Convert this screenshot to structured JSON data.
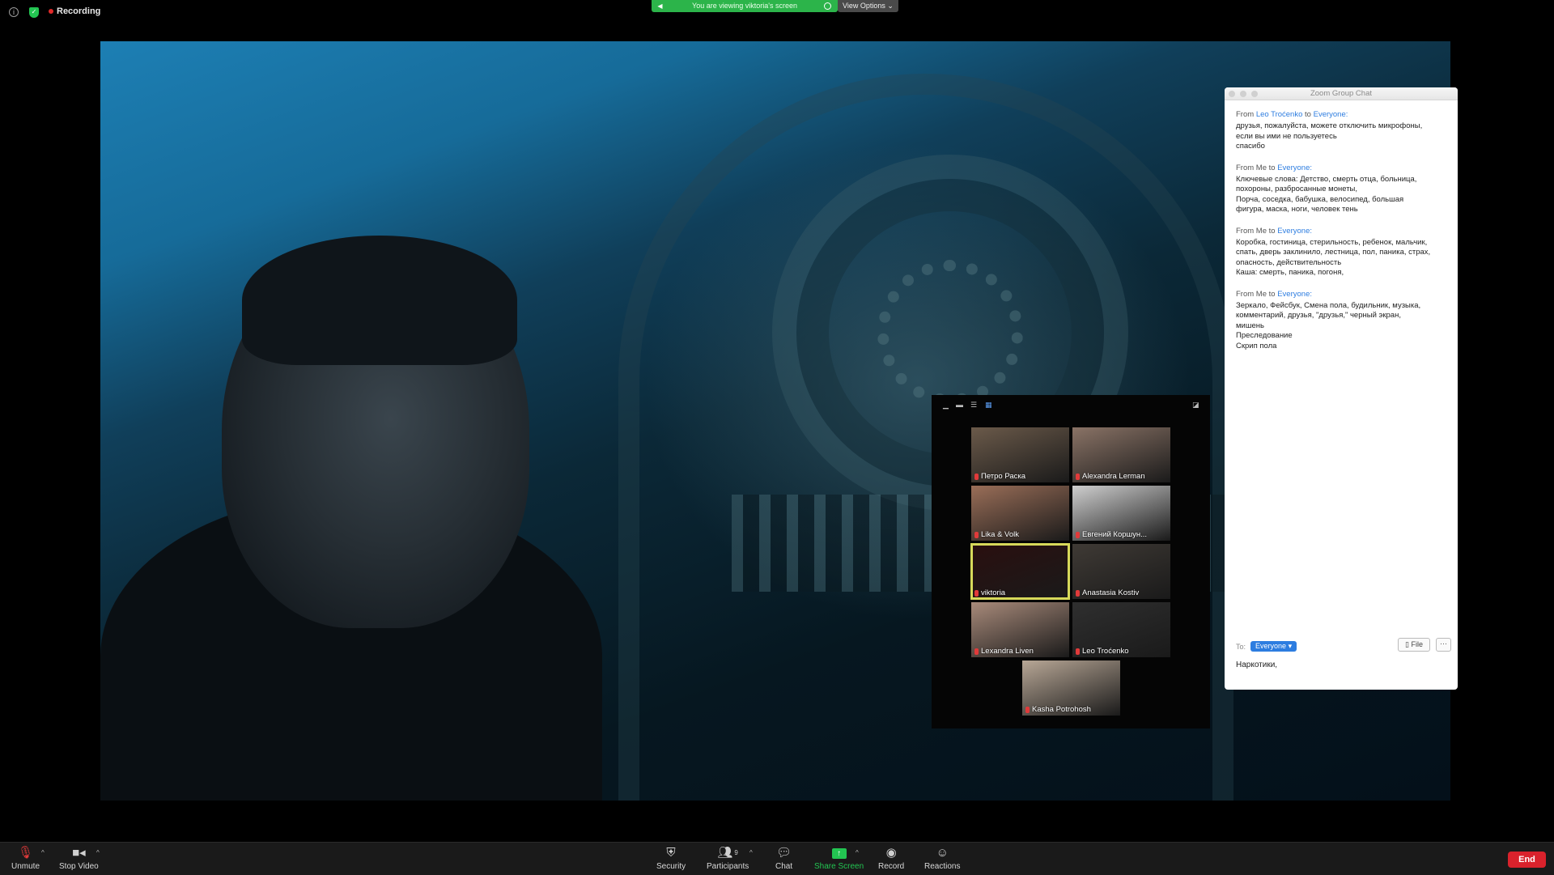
{
  "topbar": {
    "recording_label": "Recording",
    "share_banner": "You are viewing viktoria's screen",
    "view_options": "View Options"
  },
  "gallery": {
    "tiles": [
      {
        "name": "Петро Раска",
        "color": "#6b5a4a"
      },
      {
        "name": "Alexandra Lerman",
        "color": "#8a7366"
      },
      {
        "name": "Lika & Volk",
        "color": "#9a6e58"
      },
      {
        "name": "Евгений Коршун...",
        "color": "#cfcfcf"
      },
      {
        "name": "viktoria",
        "color": "#2a0f0f"
      },
      {
        "name": "Anastasia Kostiv",
        "color": "#3f3a35"
      },
      {
        "name": "Lexandra Liven",
        "color": "#a88a7a"
      },
      {
        "name": "Leo Troćenko",
        "color": "#2f2f2f"
      },
      {
        "name": "Kasha Potrohosh",
        "color": "#b8a796"
      }
    ]
  },
  "chat": {
    "title": "Zoom Group Chat",
    "messages": [
      {
        "prefix": "From",
        "sender": "Leo Troćenko",
        "mid": "to",
        "recipient": "Everyone:",
        "lines": [
          "друзья, пожалуйста, можете отключить микрофоны,",
          "если вы ими не пользуетесь",
          "спасибо"
        ]
      },
      {
        "prefix": "From Me",
        "sender": "",
        "mid": "to",
        "recipient": "Everyone:",
        "lines": [
          "Ключевые слова: Детство, смерть отца, больница,",
          "похороны, разбросанные монеты,",
          "Порча, соседка, бабушка, велосипед, большая",
          "фигура, маска, ноги, человек тень"
        ]
      },
      {
        "prefix": "From Me",
        "sender": "",
        "mid": "to",
        "recipient": "Everyone:",
        "lines": [
          "Коробка, гостиница, стерильность, ребенок, мальчик,",
          "спать, дверь заклинило, лестница, пол, паника, страх,",
          "опасность, действительность",
          "Каша: смерть, паника, погоня,"
        ]
      },
      {
        "prefix": "From Me",
        "sender": "",
        "mid": "to",
        "recipient": "Everyone:",
        "lines": [
          "Зеркало, Фейсбук, Смена пола, будильник, музыка,",
          "комментарий, друзья, \"друзья,\" черный экран,",
          "мишень",
          "Преследование",
          "Скрип пола"
        ]
      }
    ],
    "to_label": "To:",
    "to_value": "Everyone",
    "file_label": "File",
    "more_label": "···",
    "input_text": "Наркотики,"
  },
  "toolbar": {
    "unmute": "Unmute",
    "stop_video": "Stop Video",
    "security": "Security",
    "participants": "Participants",
    "participants_count": "9",
    "chat": "Chat",
    "share_screen": "Share Screen",
    "record": "Record",
    "reactions": "Reactions",
    "end": "End"
  },
  "colors": {
    "accent_green": "#23c552",
    "accent_blue": "#2d7de0",
    "end_red": "#d9222c",
    "active_speaker": "#d7d95a"
  }
}
